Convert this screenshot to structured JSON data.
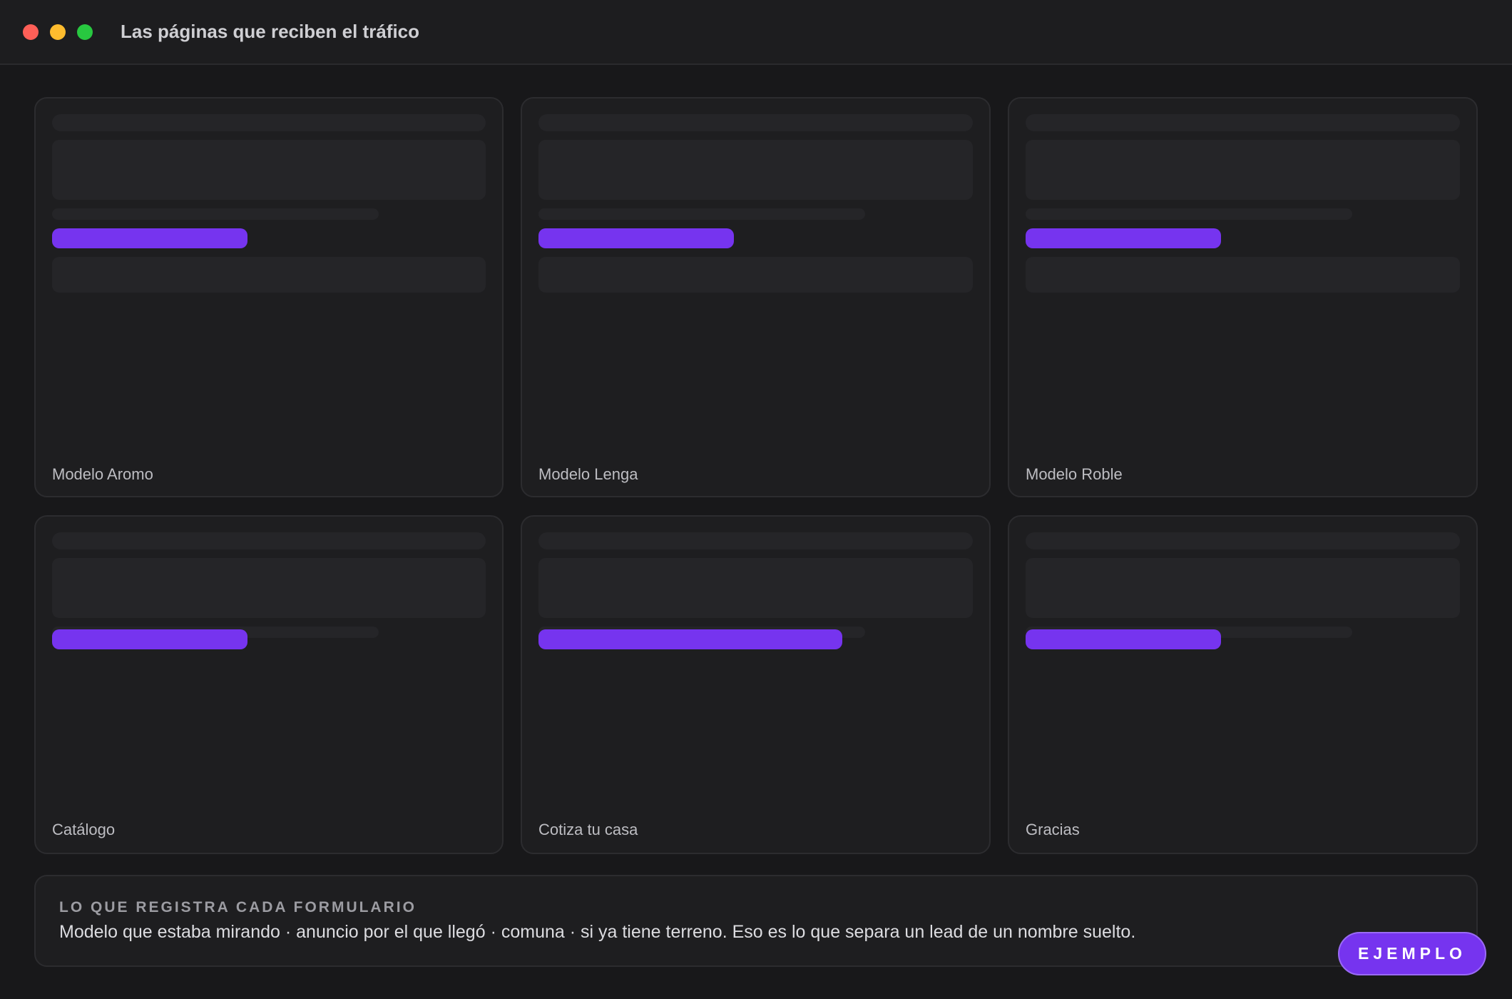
{
  "window": {
    "title": "Las páginas que reciben el tráfico"
  },
  "pages": [
    {
      "label": "Modelo Aromo",
      "highlight_fraction": 0.45
    },
    {
      "label": "Modelo Lenga",
      "highlight_fraction": 0.45
    },
    {
      "label": "Modelo Roble",
      "highlight_fraction": 0.45
    },
    {
      "label": "Catálogo",
      "highlight_fraction": 0.45
    },
    {
      "label": "Cotiza tu casa",
      "highlight_fraction": 0.7
    },
    {
      "label": "Gracias",
      "highlight_fraction": 0.45
    }
  ],
  "note": {
    "heading": "LO QUE REGISTRA CADA FORMULARIO",
    "body": "Modelo que estaba mirando · anuncio por el que llegó · comuna · si ya tiene terreno. Eso es lo que separa un lead de un nombre suelto."
  },
  "badge": {
    "label": "EJEMPLO"
  },
  "colors": {
    "accent": "#7634ef",
    "background": "#18181a",
    "card": "#1e1e20",
    "close": "#ff5f57",
    "minimize": "#febc2e",
    "zoom": "#28c840"
  }
}
